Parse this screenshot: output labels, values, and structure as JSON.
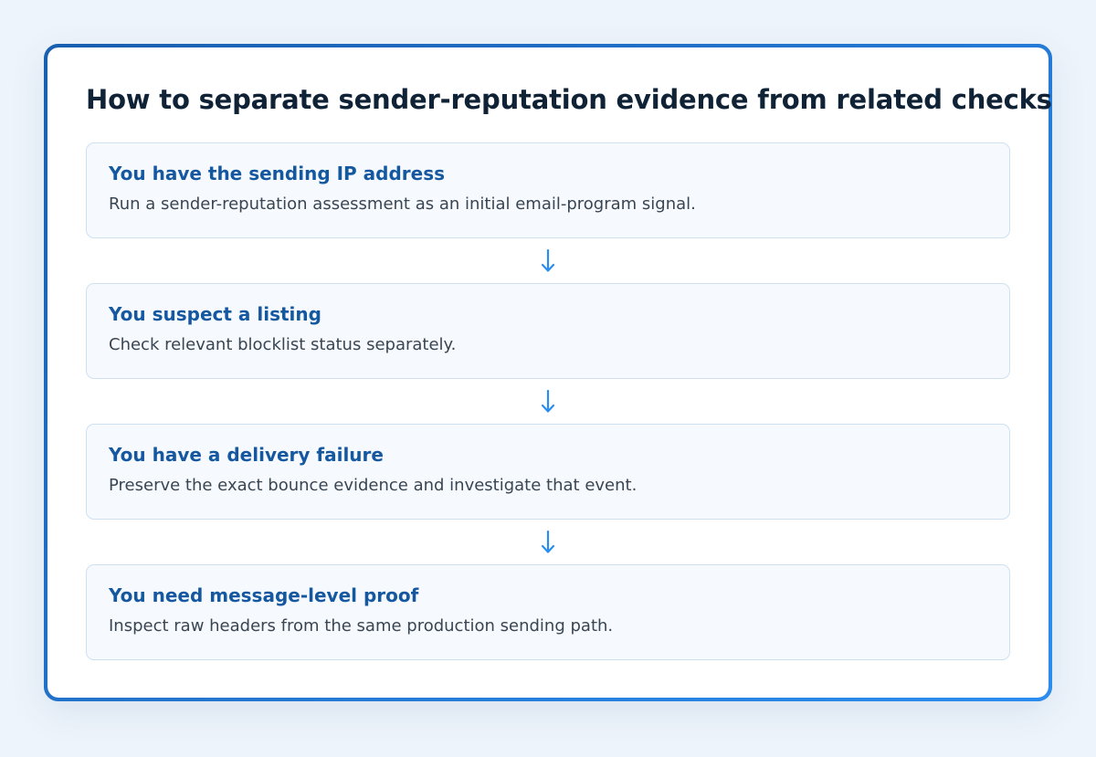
{
  "diagram": {
    "title": "How to separate sender-reputation evidence from related checks",
    "colors": {
      "card_border": "#1e73c8",
      "step_title": "#1558a0",
      "step_text": "#3a4552",
      "arrow": "#2b8df0",
      "step_background": "#f6fafe",
      "step_border": "#cfe0f1"
    },
    "steps": [
      {
        "title": "You have the sending IP address",
        "description": "Run a sender-reputation assessment as an initial email-program signal."
      },
      {
        "title": "You suspect a listing",
        "description": "Check relevant blocklist status separately."
      },
      {
        "title": "You have a delivery failure",
        "description": "Preserve the exact bounce evidence and investigate that event."
      },
      {
        "title": "You need message-level proof",
        "description": "Inspect raw headers from the same production sending path."
      }
    ],
    "connector_icon": "arrow-down-icon"
  }
}
